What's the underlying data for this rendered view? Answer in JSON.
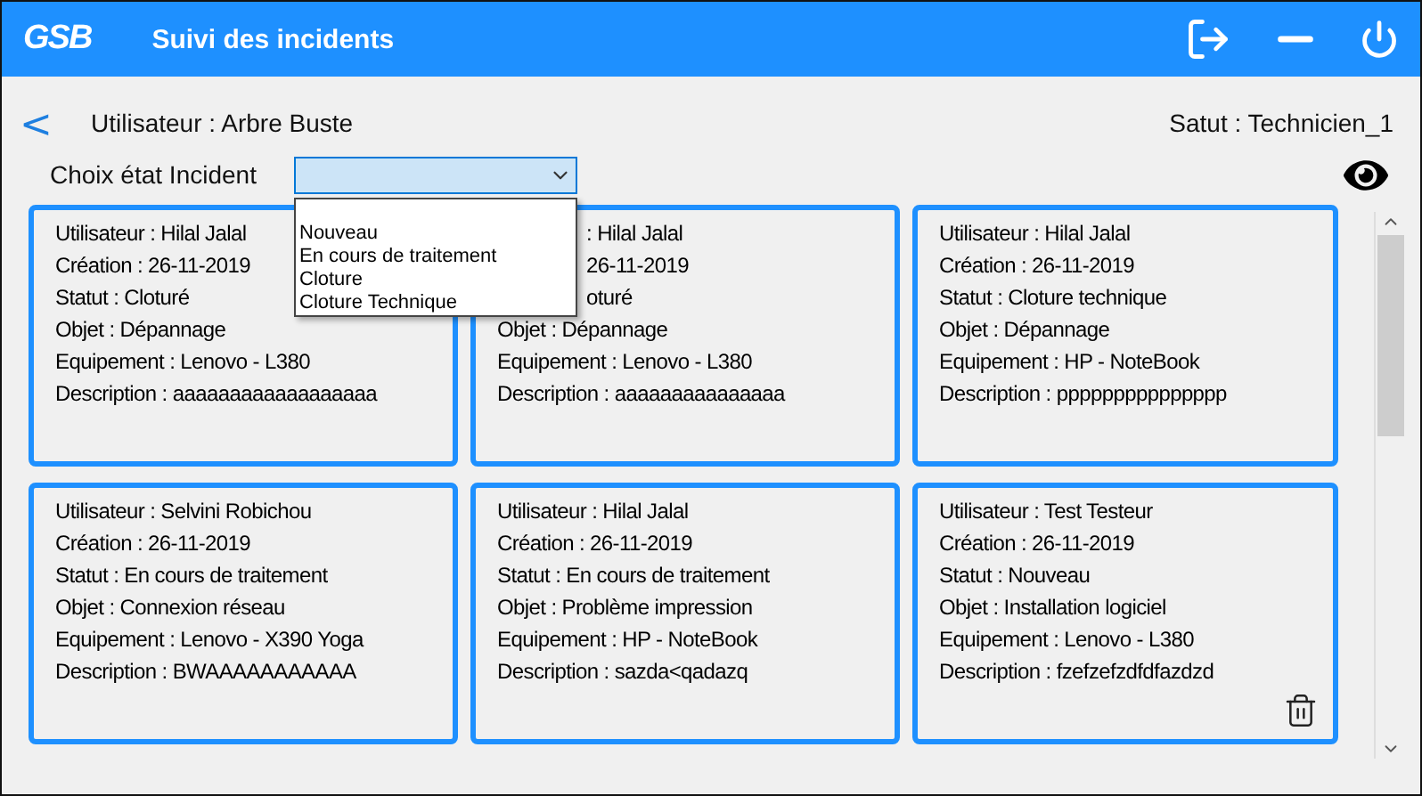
{
  "window": {
    "logo": "GSB",
    "title": "Suivi des incidents"
  },
  "header": {
    "back": "<",
    "user": "Utilisateur : Arbre Buste",
    "status": "Satut : Technicien_1"
  },
  "filter": {
    "label": "Choix état Incident",
    "expanded": true,
    "options": [
      "Nouveau",
      "En cours de traitement",
      "Cloture",
      "Cloture Technique"
    ]
  },
  "cards": [
    {
      "deletable": false,
      "lines": [
        {
          "text": "Utilisateur : Hilal Jalal",
          "covered": false
        },
        {
          "text": "Création : 26-11-2019",
          "covered": false
        },
        {
          "text": "Statut : Cloturé",
          "covered": false
        },
        {
          "text": "Objet : Dépannage",
          "covered": false
        },
        {
          "text": "Equipement : Lenovo - L380",
          "covered": false
        },
        {
          "text": "Description : aaaaaaaaaaaaaaaaaa",
          "covered": false
        }
      ]
    },
    {
      "deletable": false,
      "lines": [
        {
          "text": ": Hilal Jalal",
          "covered": true
        },
        {
          "text": "26-11-2019",
          "covered": true
        },
        {
          "text": "oturé",
          "covered": true
        },
        {
          "text": "Objet : Dépannage",
          "covered": false
        },
        {
          "text": "Equipement : Lenovo - L380",
          "covered": false
        },
        {
          "text": "Description : aaaaaaaaaaaaaaa",
          "covered": false
        }
      ]
    },
    {
      "deletable": false,
      "lines": [
        {
          "text": "Utilisateur : Hilal Jalal",
          "covered": false
        },
        {
          "text": "Création : 26-11-2019",
          "covered": false
        },
        {
          "text": "Statut : Cloture technique",
          "covered": false
        },
        {
          "text": "Objet : Dépannage",
          "covered": false
        },
        {
          "text": "Equipement : HP - NoteBook",
          "covered": false
        },
        {
          "text": "Description : ppppppppppppppp",
          "covered": false
        }
      ]
    },
    {
      "deletable": false,
      "lines": [
        {
          "text": "Utilisateur : Selvini Robichou",
          "covered": false
        },
        {
          "text": "Création : 26-11-2019",
          "covered": false
        },
        {
          "text": "Statut : En cours de traitement",
          "covered": false
        },
        {
          "text": "Objet : Connexion réseau",
          "covered": false
        },
        {
          "text": "Equipement : Lenovo - X390 Yoga",
          "covered": false
        },
        {
          "text": "Description : BWAAAAAAAAAAA",
          "covered": false
        }
      ]
    },
    {
      "deletable": false,
      "lines": [
        {
          "text": "Utilisateur : Hilal Jalal",
          "covered": false
        },
        {
          "text": "Création : 26-11-2019",
          "covered": false
        },
        {
          "text": "Statut : En cours de traitement",
          "covered": false
        },
        {
          "text": "Objet : Problème impression",
          "covered": false
        },
        {
          "text": "Equipement : HP - NoteBook",
          "covered": false
        },
        {
          "text": "Description : sazda<qadazq",
          "covered": false
        }
      ]
    },
    {
      "deletable": true,
      "lines": [
        {
          "text": "Utilisateur : Test Testeur",
          "covered": false
        },
        {
          "text": "Création : 26-11-2019",
          "covered": false
        },
        {
          "text": "Statut : Nouveau",
          "covered": false
        },
        {
          "text": "Objet : Installation logiciel",
          "covered": false
        },
        {
          "text": "Equipement : Lenovo - L380",
          "covered": false
        },
        {
          "text": "Description : fzefzefzdfdfazdzd",
          "covered": false
        }
      ]
    }
  ]
}
